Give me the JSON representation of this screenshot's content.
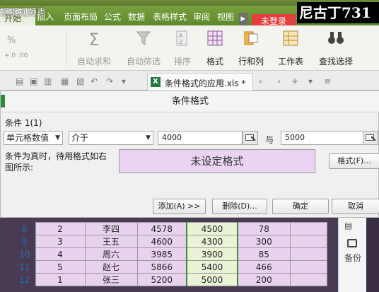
{
  "app": {
    "watermark": "抠抠视频秀",
    "overlay_name": "尼古丁731",
    "login_label": "未登录"
  },
  "menu": [
    {
      "label": "开始"
    },
    {
      "label": "插入"
    },
    {
      "label": "页面布局"
    },
    {
      "label": "公式"
    },
    {
      "label": "数据"
    },
    {
      "label": "表格样式"
    },
    {
      "label": "审阅"
    },
    {
      "label": "视图"
    }
  ],
  "ribbon": {
    "percent": "%",
    "number_format": "+.0 .00",
    "autosum": "自动求和",
    "autofilter": "自动筛选",
    "sort": "排序",
    "format": "格式",
    "rows_cols": "行和列",
    "worksheet": "工作表",
    "find_select": "查找选择"
  },
  "document": {
    "tab_name": "条件格式的应用.xls *",
    "app_badge": "X"
  },
  "dialog": {
    "title": "条件格式",
    "condition_label": "条件 1(1)",
    "type_select": "单元格数值",
    "operator_select": "介于",
    "value_from": "4000",
    "and_label": "与",
    "value_to": "5000",
    "description": "条件为真时，待用格式如右图所示:",
    "preview_text": "未设定格式",
    "format_button": "格式(F)...",
    "add_button": "添加(A) >>",
    "delete_button": "删除(D)...",
    "ok_button": "确定",
    "cancel_button": "取消"
  },
  "sheet": {
    "rows": [
      {
        "num": "8",
        "cells": [
          "2",
          "李四",
          "4578",
          "4500",
          "78",
          ""
        ]
      },
      {
        "num": "9",
        "cells": [
          "3",
          "王五",
          "4600",
          "4300",
          "300",
          ""
        ]
      },
      {
        "num": "10",
        "cells": [
          "4",
          "周六",
          "3985",
          "3900",
          "85",
          ""
        ]
      },
      {
        "num": "11",
        "cells": [
          "5",
          "赵七",
          "5866",
          "5400",
          "466",
          ""
        ]
      },
      {
        "num": "12",
        "cells": [
          "1",
          "张三",
          "5200",
          "5000",
          "200",
          ""
        ]
      }
    ],
    "side_label": "备份"
  }
}
